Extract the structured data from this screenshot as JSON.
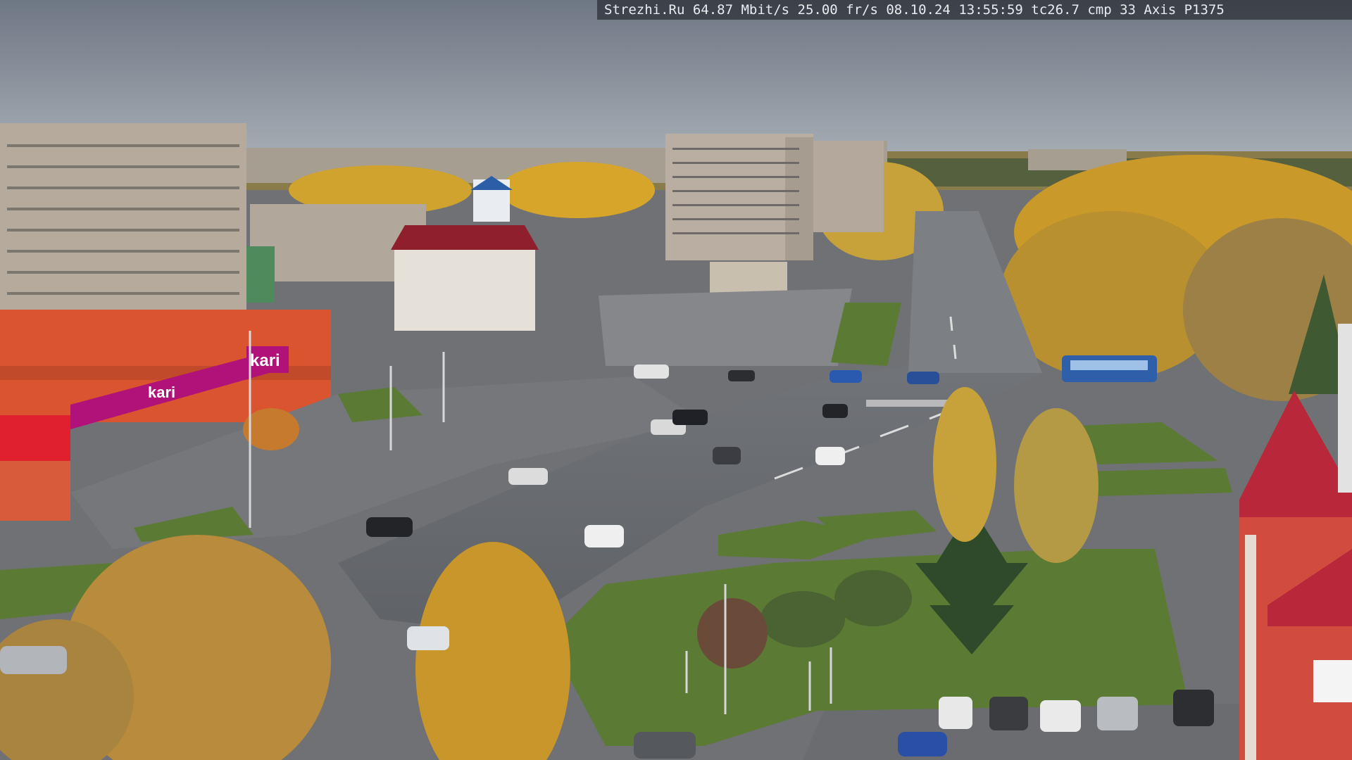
{
  "overlay": {
    "text": "Strezhi.Ru 64.87 Mbit/s 25.00 fr/s 08.10.24 13:55:59  tc26.7  cmp 33   Axis P1375"
  },
  "signs": {
    "store_brand": "kari",
    "store_brand_small": "kari"
  },
  "colors": {
    "sky": "#8f98a3",
    "asphalt": "#6d7075",
    "grass": "#5b7a34",
    "foliage": "#d6a52a",
    "store_red": "#d9542f",
    "store_magenta": "#b0127a",
    "bus": "#2f5fa8"
  }
}
